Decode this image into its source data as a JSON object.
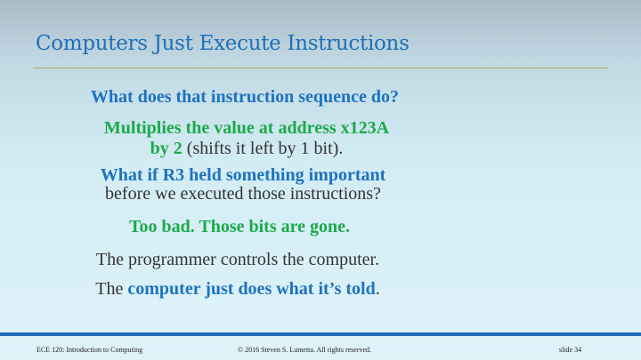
{
  "slide": {
    "title": "Computers Just Execute Instructions",
    "question1": "What does that instruction sequence do?",
    "answer1_line1": "Multiplies the value at address x123A",
    "answer1_line2_bold": "by 2",
    "answer1_line2_rest": " (shifts it left by 1 bit).",
    "question2_line1": "What if R3 held something important",
    "question2_line2": "before we executed those instructions?",
    "answer2": "Too bad.  Those bits are gone.",
    "statement1": "The programmer controls the computer.",
    "statement2_prefix": "The ",
    "statement2_bold": "computer just does what it’s told",
    "statement2_suffix": "."
  },
  "footer": {
    "course": "ECE 120: Introduction to Computing",
    "copyright": "© 2016 Steven S. Lumetta.  All rights reserved.",
    "slide_number": "slide 34"
  },
  "colors": {
    "title": "#1f6fb8",
    "blue_text": "#1d72c0",
    "green_text": "#1aab49",
    "rule": "#b9a35a",
    "footer_bar": "#1f6fb8"
  }
}
